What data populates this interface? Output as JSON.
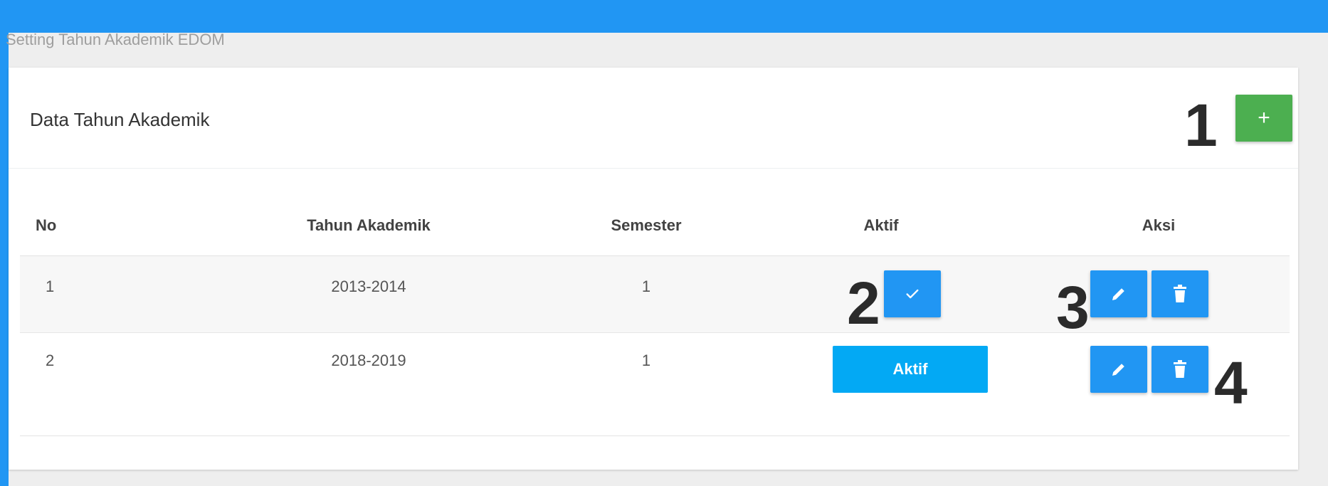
{
  "breadcrumb": "Setting Tahun Akademik EDOM",
  "card": {
    "title": "Data Tahun Akademik",
    "add_label": "+"
  },
  "markers": [
    "1",
    "2",
    "3",
    "4"
  ],
  "table": {
    "headers": [
      "No",
      "Tahun Akademik",
      "Semester",
      "Aktif",
      "Aksi"
    ],
    "rows": [
      {
        "no": "1",
        "tahun": "2013-2014",
        "semester": "1",
        "aktif_label": ""
      },
      {
        "no": "2",
        "tahun": "2018-2019",
        "semester": "1",
        "aktif_label": "Aktif"
      }
    ]
  },
  "icons": {
    "activate": "check-icon",
    "edit": "pencil-icon",
    "delete": "trash-icon"
  },
  "colors": {
    "primary": "#2196f3",
    "success": "#4caf50",
    "info": "#03a9f4"
  }
}
